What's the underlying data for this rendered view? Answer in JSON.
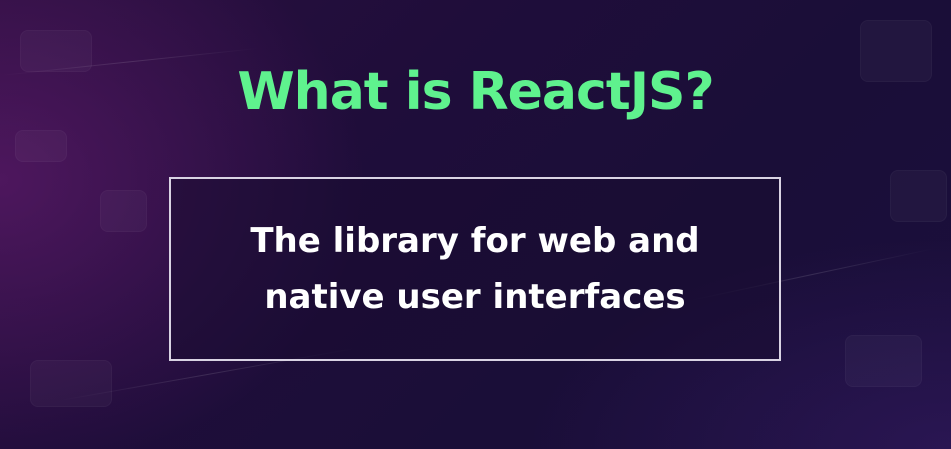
{
  "heading": {
    "title": "What is ReactJS?"
  },
  "definition": {
    "line1": "The library for web and",
    "line2": "native user interfaces"
  },
  "colors": {
    "title": "#5ff28e",
    "text": "#ffffff",
    "box_border": "#d9d3e3",
    "background": "#1c0e3a"
  }
}
